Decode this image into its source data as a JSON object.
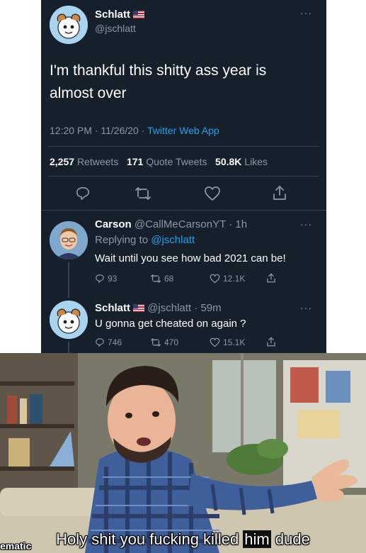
{
  "main_tweet": {
    "author_name": "Schlatt",
    "author_handle": "@jschlatt",
    "text_line1": "I'm thankful this shitty ass year is",
    "text_line2": "almost over",
    "time_date": "12:20 PM · 11/26/20 · ",
    "source": "Twitter Web App",
    "retweets_count": "2,257",
    "retweets_label": "Retweets",
    "quotes_count": "171",
    "quotes_label": "Quote Tweets",
    "likes_count": "50.8K",
    "likes_label": "Likes"
  },
  "replies": [
    {
      "author_name": "Carson",
      "author_handle": "@CallMeCarsonYT",
      "age": "· 1h",
      "replying_label": "Replying to ",
      "replying_to": "@jschlatt",
      "text": "Wait until you see how bad 2021 can be!",
      "replies": "93",
      "retweets": "68",
      "likes": "12.1K"
    },
    {
      "author_name": "Schlatt",
      "author_handle": "@jschlatt",
      "age": "· 59m",
      "text": "U gonna get cheated on again ?",
      "replies": "746",
      "retweets": "470",
      "likes": "15.1K"
    }
  ],
  "more_glyph": "···",
  "meme": {
    "caption_a": "Holy shit you fucking killed ",
    "caption_b": "him",
    "caption_c": " dude",
    "watermark": "ematic"
  },
  "colors": {
    "background": "#15202b",
    "accent": "#1da1f2",
    "muted": "#8899a6",
    "divider": "#38444d"
  },
  "icons": [
    "reply-icon",
    "retweet-icon",
    "like-icon",
    "share-icon",
    "us-flag-icon",
    "more-icon"
  ]
}
